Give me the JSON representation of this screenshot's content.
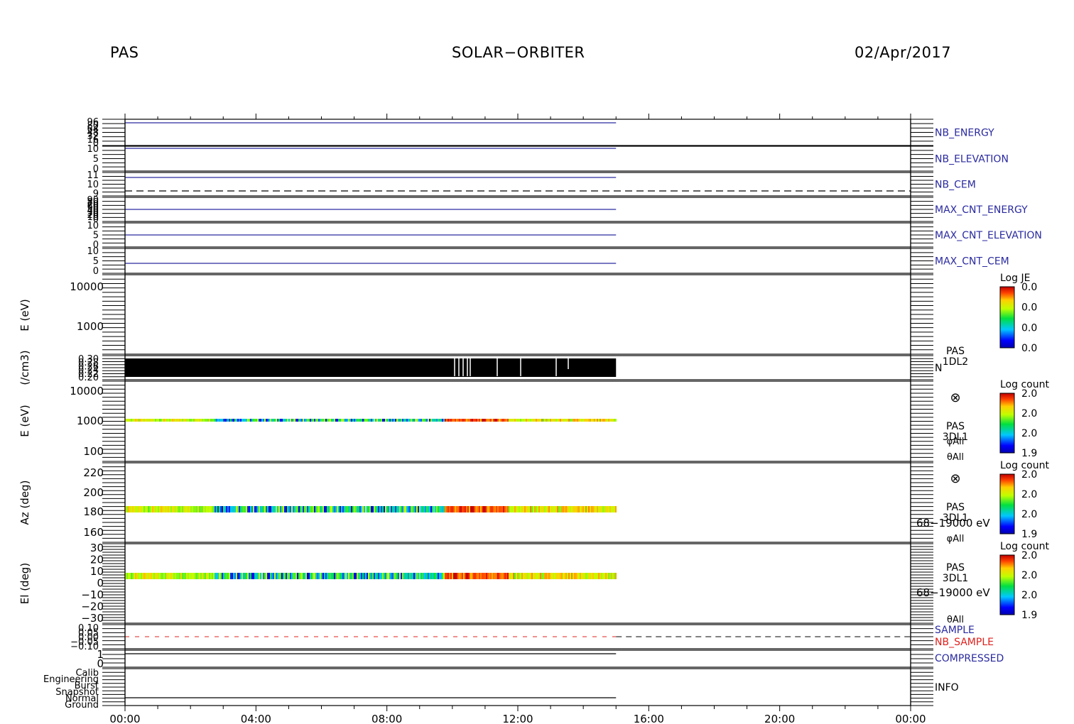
{
  "header": {
    "left": "PAS",
    "center": "SOLAR−ORBITER",
    "right": "02/Apr/2017"
  },
  "colors": {
    "hk_label": "#2a2aa0",
    "nb_sample_label": "#e0201c",
    "trace": "#2a2aa0",
    "axis": "#000000"
  },
  "chart_data": {
    "type": "multi-panel time series",
    "x_axis": {
      "range": [
        "00:00",
        "24:00"
      ],
      "tick_labels": [
        "00:00",
        "04:00",
        "08:00",
        "12:00",
        "16:00",
        "20:00",
        "00:00"
      ],
      "data_end": "15:00"
    },
    "panels": [
      {
        "id": "nb_energy",
        "label": "NB_ENERGY",
        "label_color": "#2a2aa0",
        "tick_labels": [
          "96",
          "80",
          "64",
          "48",
          "32",
          "16",
          "0"
        ],
        "line_value": 96
      },
      {
        "id": "nb_elevation",
        "label": "NB_ELEVATION",
        "label_color": "#2a2aa0",
        "tick_labels": [
          "10",
          "5",
          "0"
        ],
        "line_value": 10
      },
      {
        "id": "nb_cem",
        "label": "NB_CEM",
        "label_color": "#2a2aa0",
        "tick_labels": [
          "11",
          "10",
          "9"
        ],
        "line_value": 11
      },
      {
        "id": "max_cnt_energy",
        "label": "MAX_CNT_ENERGY",
        "label_color": "#2a2aa0",
        "tick_labels": [
          "90",
          "80",
          "70",
          "60",
          "50",
          "40",
          "30",
          "20",
          "10",
          "0"
        ],
        "line_value": 50
      },
      {
        "id": "max_cnt_elevation",
        "label": "MAX_CNT_ELEVATION",
        "label_color": "#2a2aa0",
        "tick_labels": [
          "10",
          "5",
          "0"
        ],
        "line_value": 4
      },
      {
        "id": "max_cnt_cem",
        "label": "MAX_CNT_CEM",
        "label_color": "#2a2aa0",
        "tick_labels": [
          "10",
          "5",
          "0"
        ],
        "line_value": 3
      },
      {
        "id": "pas_1dl2_spec",
        "ylabel": "E (eV)",
        "tick_labels": [
          "10000",
          "1000"
        ],
        "colorbar": {
          "title": "Log JE",
          "labels": [
            "0.0",
            "0.0",
            "0.0",
            "0.0"
          ]
        }
      },
      {
        "id": "pas_1dl2_density",
        "ylabel": "(/cm3)",
        "tick_labels": [
          "0.30",
          "0.28",
          "0.26",
          "0.24",
          "0.22",
          "0.20"
        ],
        "side_text": [
          "PAS",
          "1DL2",
          "N"
        ]
      },
      {
        "id": "pas_3dl1_energy",
        "ylabel": "E (eV)",
        "tick_labels": [
          "10000",
          "1000",
          "100"
        ],
        "band_value": 1100,
        "side_text": [
          "PAS",
          "3DL1",
          "φAll",
          "θAll"
        ],
        "symbol": "⊗",
        "colorbar": {
          "title": "Log count",
          "labels": [
            "2.0",
            "2.0",
            "2.0",
            "1.9"
          ]
        }
      },
      {
        "id": "pas_3dl1_azimuth",
        "ylabel": "Az (deg)",
        "tick_labels": [
          "220",
          "200",
          "180",
          "160"
        ],
        "band_value": 183,
        "side_text": [
          "PAS",
          "3DL1",
          "68−19000 eV",
          "φAll"
        ],
        "symbol": "⊗",
        "colorbar": {
          "title": "Log count",
          "labels": [
            "2.0",
            "2.0",
            "2.0",
            "1.9"
          ]
        }
      },
      {
        "id": "pas_3dl1_elevation",
        "ylabel": "El (deg)",
        "tick_labels": [
          "30",
          "20",
          "10",
          "0",
          "−10",
          "−20",
          "−30"
        ],
        "band_value": 7,
        "side_text": [
          "PAS",
          "3DL1",
          "68−19000 eV",
          "θAll"
        ],
        "colorbar": {
          "title": "Log count",
          "labels": [
            "2.0",
            "2.0",
            "2.0",
            "1.9"
          ]
        }
      },
      {
        "id": "sample",
        "labels": [
          "SAMPLE",
          "NB_SAMPLE"
        ],
        "label_colors": [
          "#2a2aa0",
          "#e0201c"
        ],
        "tick_labels": [
          "0.10",
          "0.05",
          "0.00",
          "−0.05",
          "−0.10"
        ]
      },
      {
        "id": "compressed",
        "label": "COMPRESSED",
        "label_color": "#2a2aa0",
        "tick_labels": [
          "1",
          "0"
        ],
        "line_value": 1
      },
      {
        "id": "info",
        "label": "INFO",
        "tick_labels": [
          "Calib",
          "Engineering",
          "Burst",
          "Snapshot",
          "Normal",
          "Ground"
        ],
        "line_value": "Normal"
      }
    ]
  }
}
